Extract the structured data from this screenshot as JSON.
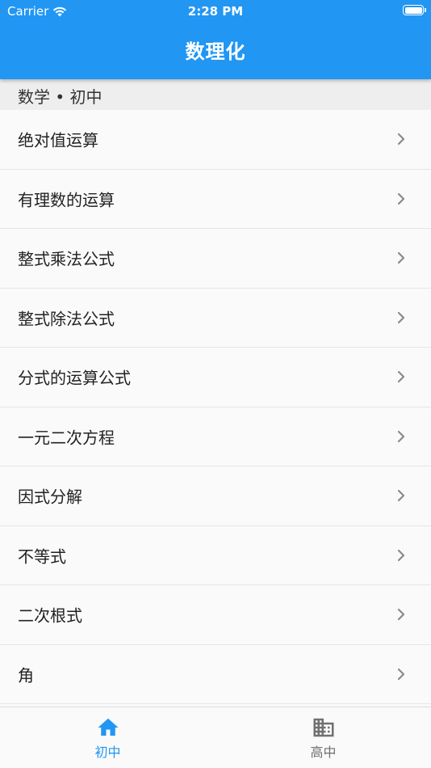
{
  "status_bar": {
    "carrier": "Carrier",
    "time": "2:28 PM",
    "wifi_icon": "wifi-icon",
    "battery_icon": "battery-icon"
  },
  "app_bar": {
    "title": "数理化"
  },
  "section": {
    "header": "数学 • 初中"
  },
  "list": {
    "chevron_icon": "chevron-right-icon",
    "items": [
      {
        "label": "绝对值运算"
      },
      {
        "label": "有理数的运算"
      },
      {
        "label": "整式乘法公式"
      },
      {
        "label": "整式除法公式"
      },
      {
        "label": "分式的运算公式"
      },
      {
        "label": "一元二次方程"
      },
      {
        "label": "因式分解"
      },
      {
        "label": "不等式"
      },
      {
        "label": "二次根式"
      },
      {
        "label": "角"
      }
    ]
  },
  "tab_bar": {
    "tabs": [
      {
        "label": "初中",
        "icon": "home-icon",
        "active": true
      },
      {
        "label": "高中",
        "icon": "building-icon",
        "active": false
      }
    ]
  },
  "colors": {
    "primary": "#2196f3",
    "inactive_tab": "#707070",
    "section_bg": "#eeeeee"
  }
}
